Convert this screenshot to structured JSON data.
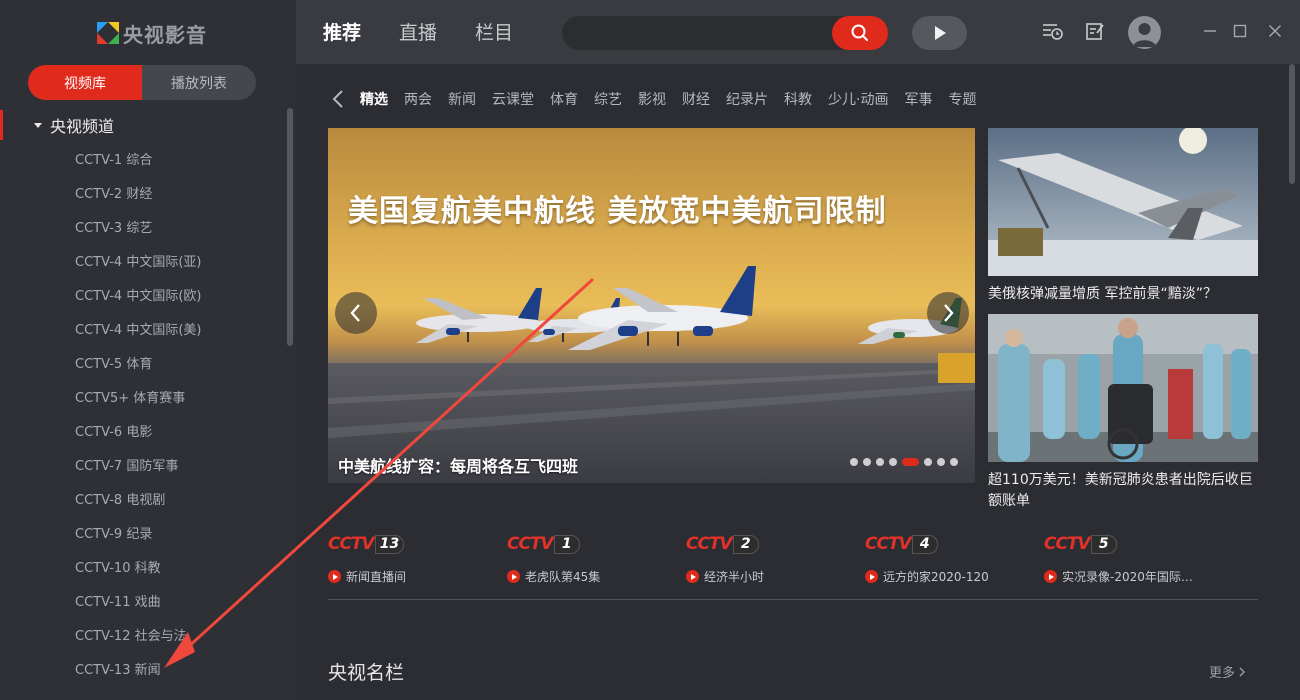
{
  "app": {
    "logo_text": "央视影音"
  },
  "sidebar": {
    "tabs": [
      "视频库",
      "播放列表"
    ],
    "group": "央视频道",
    "channels": [
      "CCTV-1 综合",
      "CCTV-2 财经",
      "CCTV-3 综艺",
      "CCTV-4 中文国际(亚)",
      "CCTV-4 中文国际(欧)",
      "CCTV-4 中文国际(美)",
      "CCTV-5 体育",
      "CCTV5+ 体育赛事",
      "CCTV-6 电影",
      "CCTV-7 国防军事",
      "CCTV-8 电视剧",
      "CCTV-9 纪录",
      "CCTV-10 科教",
      "CCTV-11 戏曲",
      "CCTV-12 社会与法",
      "CCTV-13 新闻"
    ]
  },
  "topbar": {
    "nav": [
      "推荐",
      "直播",
      "栏目"
    ],
    "search": {
      "value": "",
      "placeholder": ""
    }
  },
  "main": {
    "categories": [
      "精选",
      "两会",
      "新闻",
      "云课堂",
      "体育",
      "综艺",
      "影视",
      "财经",
      "纪录片",
      "科教",
      "少儿·动画",
      "军事",
      "专题"
    ],
    "hero": {
      "overlay_title": "美国复航美中航线 美放宽中美航司限制",
      "caption": "中美航线扩容：每周将各互飞四班",
      "dots": 8,
      "active_dot": 5
    },
    "side_cards": [
      {
        "caption": "美俄核弹减量增质 军控前景“黯淡”？"
      },
      {
        "caption": "超110万美元！美新冠肺炎患者出院后收巨额账单"
      }
    ],
    "channel_cards": [
      {
        "logo": "CCTV",
        "number": "13",
        "program": "新闻直播间"
      },
      {
        "logo": "CCTV",
        "number": "1",
        "program": "老虎队第45集"
      },
      {
        "logo": "CCTV",
        "number": "2",
        "program": "经济半小时"
      },
      {
        "logo": "CCTV",
        "number": "4",
        "program": "远方的家2020-120"
      },
      {
        "logo": "CCTV",
        "number": "5",
        "program": "实况录像-2020年国际…"
      }
    ],
    "section_title": "央视名栏",
    "more_label": "更多"
  },
  "colors": {
    "accent": "#e02a1c",
    "sidebar_bg": "#2e3035",
    "topbar_bg": "#393b41",
    "main_bg": "#2b2d33"
  }
}
